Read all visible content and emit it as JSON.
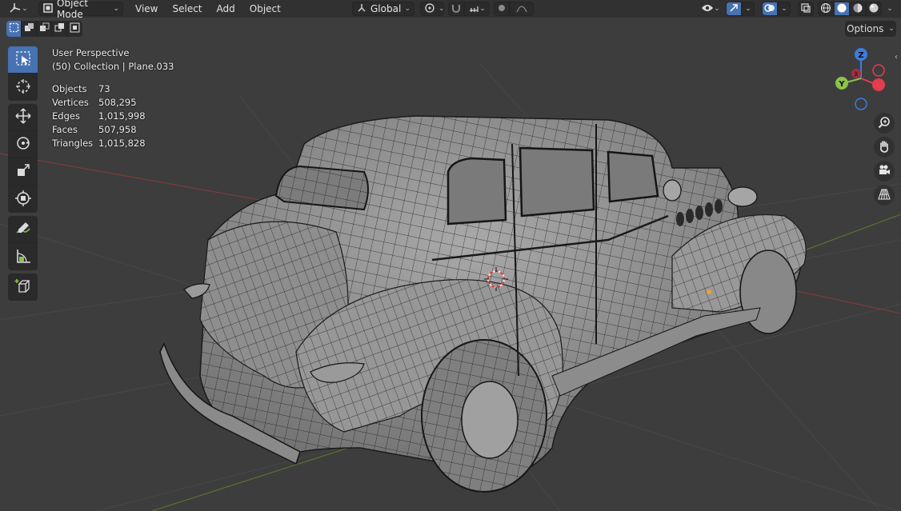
{
  "header": {
    "mode_label": "Object Mode",
    "menus": [
      {
        "id": "view",
        "label": "View"
      },
      {
        "id": "select",
        "label": "Select"
      },
      {
        "id": "add",
        "label": "Add"
      },
      {
        "id": "object",
        "label": "Object"
      }
    ],
    "transform_orientation": "Global",
    "options_label": "Options"
  },
  "overlay": {
    "view_name": "User Perspective",
    "collection_info": "(50) Collection | Plane.033",
    "stats": [
      {
        "label": "Objects",
        "value": "73"
      },
      {
        "label": "Vertices",
        "value": "508,295"
      },
      {
        "label": "Edges",
        "value": "1,015,998"
      },
      {
        "label": "Faces",
        "value": "507,958"
      },
      {
        "label": "Triangles",
        "value": "1,015,828"
      }
    ]
  },
  "gizmo": {
    "x": "X",
    "y": "Y",
    "z": "Z"
  },
  "colors": {
    "accent": "#4772b3",
    "viewport_bg": "#3d3d3d",
    "header_bg": "#303030",
    "axis_x": "#e23d4e",
    "axis_y": "#8bc34a",
    "axis_z": "#3d7bdc"
  },
  "icons": {
    "editor_type": "axes-editor-icon",
    "mode": "object-mode-icon",
    "tools": [
      "select-box-icon",
      "cursor-icon",
      "move-icon",
      "rotate-icon",
      "scale-icon",
      "transform-icon",
      "annotate-icon",
      "measure-icon",
      "add-cube-icon"
    ],
    "nav": [
      "zoom-icon",
      "hand-pan-icon",
      "camera-icon",
      "grid-perspective-icon"
    ]
  }
}
